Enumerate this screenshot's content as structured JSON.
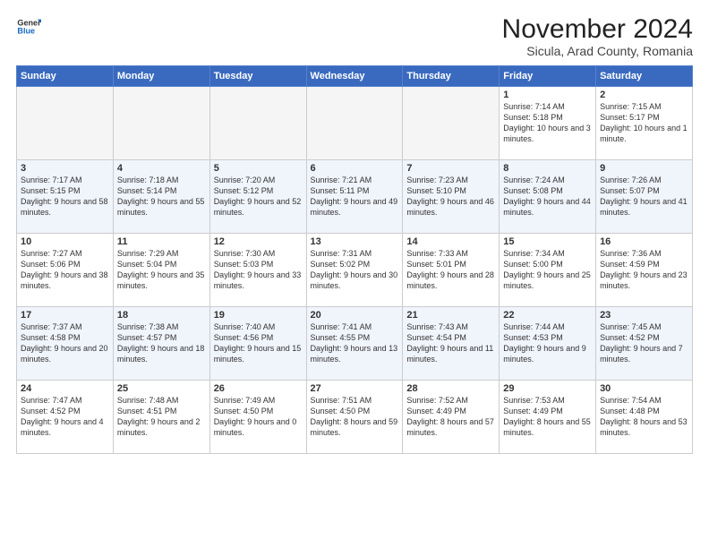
{
  "logo": {
    "general": "General",
    "blue": "Blue"
  },
  "title": "November 2024",
  "subtitle": "Sicula, Arad County, Romania",
  "headers": [
    "Sunday",
    "Monday",
    "Tuesday",
    "Wednesday",
    "Thursday",
    "Friday",
    "Saturday"
  ],
  "weeks": [
    [
      {
        "day": "",
        "text": ""
      },
      {
        "day": "",
        "text": ""
      },
      {
        "day": "",
        "text": ""
      },
      {
        "day": "",
        "text": ""
      },
      {
        "day": "",
        "text": ""
      },
      {
        "day": "1",
        "text": "Sunrise: 7:14 AM\nSunset: 5:18 PM\nDaylight: 10 hours\nand 3 minutes."
      },
      {
        "day": "2",
        "text": "Sunrise: 7:15 AM\nSunset: 5:17 PM\nDaylight: 10 hours\nand 1 minute."
      }
    ],
    [
      {
        "day": "3",
        "text": "Sunrise: 7:17 AM\nSunset: 5:15 PM\nDaylight: 9 hours\nand 58 minutes."
      },
      {
        "day": "4",
        "text": "Sunrise: 7:18 AM\nSunset: 5:14 PM\nDaylight: 9 hours\nand 55 minutes."
      },
      {
        "day": "5",
        "text": "Sunrise: 7:20 AM\nSunset: 5:12 PM\nDaylight: 9 hours\nand 52 minutes."
      },
      {
        "day": "6",
        "text": "Sunrise: 7:21 AM\nSunset: 5:11 PM\nDaylight: 9 hours\nand 49 minutes."
      },
      {
        "day": "7",
        "text": "Sunrise: 7:23 AM\nSunset: 5:10 PM\nDaylight: 9 hours\nand 46 minutes."
      },
      {
        "day": "8",
        "text": "Sunrise: 7:24 AM\nSunset: 5:08 PM\nDaylight: 9 hours\nand 44 minutes."
      },
      {
        "day": "9",
        "text": "Sunrise: 7:26 AM\nSunset: 5:07 PM\nDaylight: 9 hours\nand 41 minutes."
      }
    ],
    [
      {
        "day": "10",
        "text": "Sunrise: 7:27 AM\nSunset: 5:06 PM\nDaylight: 9 hours\nand 38 minutes."
      },
      {
        "day": "11",
        "text": "Sunrise: 7:29 AM\nSunset: 5:04 PM\nDaylight: 9 hours\nand 35 minutes."
      },
      {
        "day": "12",
        "text": "Sunrise: 7:30 AM\nSunset: 5:03 PM\nDaylight: 9 hours\nand 33 minutes."
      },
      {
        "day": "13",
        "text": "Sunrise: 7:31 AM\nSunset: 5:02 PM\nDaylight: 9 hours\nand 30 minutes."
      },
      {
        "day": "14",
        "text": "Sunrise: 7:33 AM\nSunset: 5:01 PM\nDaylight: 9 hours\nand 28 minutes."
      },
      {
        "day": "15",
        "text": "Sunrise: 7:34 AM\nSunset: 5:00 PM\nDaylight: 9 hours\nand 25 minutes."
      },
      {
        "day": "16",
        "text": "Sunrise: 7:36 AM\nSunset: 4:59 PM\nDaylight: 9 hours\nand 23 minutes."
      }
    ],
    [
      {
        "day": "17",
        "text": "Sunrise: 7:37 AM\nSunset: 4:58 PM\nDaylight: 9 hours\nand 20 minutes."
      },
      {
        "day": "18",
        "text": "Sunrise: 7:38 AM\nSunset: 4:57 PM\nDaylight: 9 hours\nand 18 minutes."
      },
      {
        "day": "19",
        "text": "Sunrise: 7:40 AM\nSunset: 4:56 PM\nDaylight: 9 hours\nand 15 minutes."
      },
      {
        "day": "20",
        "text": "Sunrise: 7:41 AM\nSunset: 4:55 PM\nDaylight: 9 hours\nand 13 minutes."
      },
      {
        "day": "21",
        "text": "Sunrise: 7:43 AM\nSunset: 4:54 PM\nDaylight: 9 hours\nand 11 minutes."
      },
      {
        "day": "22",
        "text": "Sunrise: 7:44 AM\nSunset: 4:53 PM\nDaylight: 9 hours\nand 9 minutes."
      },
      {
        "day": "23",
        "text": "Sunrise: 7:45 AM\nSunset: 4:52 PM\nDaylight: 9 hours\nand 7 minutes."
      }
    ],
    [
      {
        "day": "24",
        "text": "Sunrise: 7:47 AM\nSunset: 4:52 PM\nDaylight: 9 hours\nand 4 minutes."
      },
      {
        "day": "25",
        "text": "Sunrise: 7:48 AM\nSunset: 4:51 PM\nDaylight: 9 hours\nand 2 minutes."
      },
      {
        "day": "26",
        "text": "Sunrise: 7:49 AM\nSunset: 4:50 PM\nDaylight: 9 hours\nand 0 minutes."
      },
      {
        "day": "27",
        "text": "Sunrise: 7:51 AM\nSunset: 4:50 PM\nDaylight: 8 hours\nand 59 minutes."
      },
      {
        "day": "28",
        "text": "Sunrise: 7:52 AM\nSunset: 4:49 PM\nDaylight: 8 hours\nand 57 minutes."
      },
      {
        "day": "29",
        "text": "Sunrise: 7:53 AM\nSunset: 4:49 PM\nDaylight: 8 hours\nand 55 minutes."
      },
      {
        "day": "30",
        "text": "Sunrise: 7:54 AM\nSunset: 4:48 PM\nDaylight: 8 hours\nand 53 minutes."
      }
    ]
  ]
}
